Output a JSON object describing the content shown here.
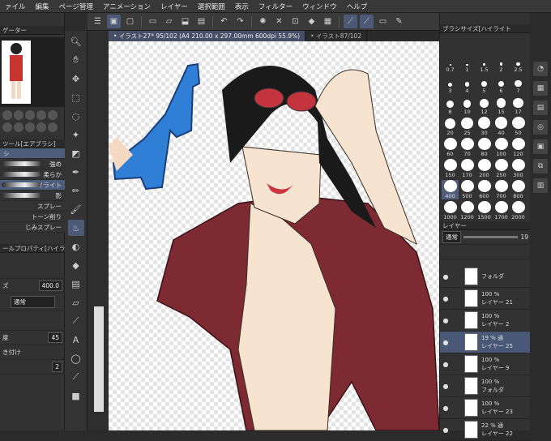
{
  "menu": [
    "ァイル",
    "編集",
    "ページ管理",
    "アニメーション",
    "レイヤー",
    "選択範囲",
    "表示",
    "フィルター",
    "ウィンドウ",
    "ヘルプ"
  ],
  "tabs": [
    {
      "label": "• イラスト27* 95/102 (A4 210.00 x 297.00mm 600dpi 55.9%)"
    },
    {
      "label": "• イラスト87/102"
    }
  ],
  "navigator": {
    "title": "ゲーター"
  },
  "subtool": {
    "title": "ツール[エアブラシ]",
    "group": "シ",
    "brushes": [
      "強め",
      "柔らか",
      "ハイライト",
      "影"
    ],
    "extra": [
      "スプレー",
      "トーン削り",
      "じみスプレー"
    ]
  },
  "toolprop": {
    "title": "ールプロパティ[ハイライト",
    "size_label": "ズ",
    "size_value": "400.0",
    "blend_value": "通常",
    "density_label": "度",
    "density_value": "45",
    "label_sticky": "き付け",
    "last_value": "2"
  },
  "brushsize": {
    "title": "ブラシサイズ[ハイライト",
    "sizes": [
      "0.7",
      "1",
      "1.5",
      "2",
      "2.5",
      "3",
      "4",
      "5",
      "6",
      "7",
      "8",
      "10",
      "12",
      "15",
      "17",
      "20",
      "25",
      "30",
      "40",
      "50",
      "60",
      "70",
      "80",
      "100",
      "120",
      "150",
      "170",
      "200",
      "250",
      "300",
      "400",
      "500",
      "600",
      "700",
      "800",
      "1000",
      "1200",
      "1500",
      "1700",
      "2000"
    ],
    "selected": "400"
  },
  "layer": {
    "title": "レイヤー",
    "blend": "通常",
    "opacity": "19",
    "rows": [
      {
        "pct": "",
        "name": "フォルダ"
      },
      {
        "pct": "100 %",
        "name": "レイヤー 21"
      },
      {
        "pct": "100 %",
        "name": "レイヤー 2"
      },
      {
        "pct": "19 % 通",
        "name": "レイヤー 25"
      },
      {
        "pct": "100 %",
        "name": "レイヤー 9"
      },
      {
        "pct": "100 %",
        "name": "フォルダ"
      },
      {
        "pct": "100 %",
        "name": "レイヤー 23"
      },
      {
        "pct": "22 % 通",
        "name": "レイヤー 22"
      }
    ]
  }
}
